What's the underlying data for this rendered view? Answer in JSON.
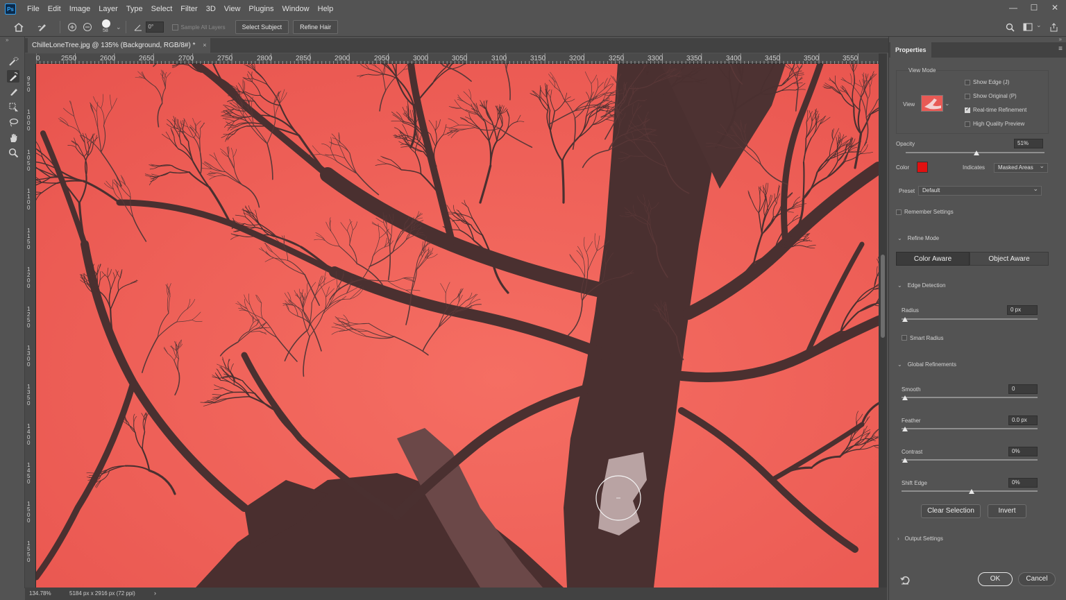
{
  "app": {
    "logo_text": "Ps"
  },
  "menu": [
    "File",
    "Edit",
    "Image",
    "Layer",
    "Type",
    "Select",
    "Filter",
    "3D",
    "View",
    "Plugins",
    "Window",
    "Help"
  ],
  "window_controls": {
    "minimize": "—",
    "maximize": "☐",
    "close": "✕"
  },
  "options_bar": {
    "brush_size": "58",
    "angle_value": "0°",
    "sample_all_layers": "Sample All Layers",
    "select_subject": "Select Subject",
    "refine_hair": "Refine Hair"
  },
  "document": {
    "tab_title": "ChilleLoneTree.jpg @ 135% (Background, RGB/8#) *",
    "close": "×"
  },
  "ruler_top": [
    "0",
    "2550",
    "2600",
    "2650",
    "2700",
    "2750",
    "2800",
    "2850",
    "2900",
    "2950",
    "3000",
    "3050",
    "3100",
    "3150",
    "3200",
    "3250",
    "3300",
    "3350",
    "3400",
    "3450",
    "3500",
    "3550"
  ],
  "ruler_left": [
    "950",
    "1000",
    "1050",
    "1100",
    "1150",
    "1200",
    "1250",
    "1300",
    "1350",
    "1400",
    "1450",
    "1500",
    "1550"
  ],
  "status": {
    "zoom": "134.78%",
    "doc_size": "5184 px x 2916 px (72 ppi)",
    "arrow": "›"
  },
  "panel": {
    "tab": "Properties",
    "view_mode": "View Mode",
    "view_label": "View",
    "show_edge": "Show Edge (J)",
    "show_original": "Show Original (P)",
    "realtime": "Real-time Refinement",
    "hq_preview": "High Quality Preview",
    "opacity_label": "Opacity",
    "opacity_value": "51%",
    "opacity_fraction": 0.51,
    "color_label": "Color",
    "overlay_color": "#e01010",
    "indicates_label": "Indicates",
    "indicates_value": "Masked Areas",
    "preset_label": "Preset",
    "preset_value": "Default",
    "remember": "Remember Settings",
    "refine_mode": "Refine Mode",
    "color_aware": "Color Aware",
    "object_aware": "Object Aware",
    "edge_detection": "Edge Detection",
    "radius_label": "Radius",
    "radius_value": "0 px",
    "smart_radius": "Smart Radius",
    "global_refinements": "Global Refinements",
    "smooth_label": "Smooth",
    "smooth_value": "0",
    "feather_label": "Feather",
    "feather_value": "0.0 px",
    "contrast_label": "Contrast",
    "contrast_value": "0%",
    "shift_label": "Shift Edge",
    "shift_value": "0%",
    "clear_selection": "Clear Selection",
    "invert": "Invert",
    "output_settings": "Output Settings",
    "ok": "OK",
    "cancel": "Cancel"
  },
  "colors": {
    "overlay_red": "#f06059",
    "branch": "#4a3030",
    "ui_bg": "#535353"
  }
}
